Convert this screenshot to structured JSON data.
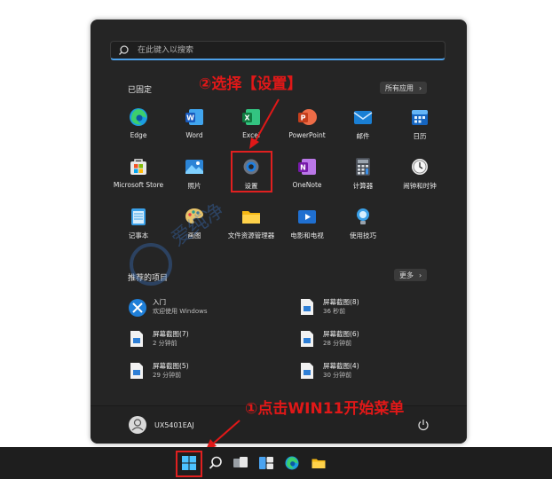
{
  "search": {
    "placeholder": "在此键入以搜索"
  },
  "pinned": {
    "title": "已固定",
    "all_apps": "所有应用",
    "apps": [
      {
        "label": "Edge"
      },
      {
        "label": "Word"
      },
      {
        "label": "Excel"
      },
      {
        "label": "PowerPoint"
      },
      {
        "label": "邮件"
      },
      {
        "label": "日历"
      },
      {
        "label": "Microsoft Store"
      },
      {
        "label": "照片"
      },
      {
        "label": "设置"
      },
      {
        "label": "OneNote"
      },
      {
        "label": "计算器"
      },
      {
        "label": "闹钟和时钟"
      },
      {
        "label": "记事本"
      },
      {
        "label": "画图"
      },
      {
        "label": "文件资源管理器"
      },
      {
        "label": "电影和电视"
      },
      {
        "label": "使用技巧"
      }
    ]
  },
  "recommended": {
    "title": "推荐的项目",
    "more": "更多",
    "items": [
      {
        "title": "入门",
        "subtitle": "欢迎使用 Windows"
      },
      {
        "title": "屏幕截图(8)",
        "subtitle": "36 秒前"
      },
      {
        "title": "屏幕截图(7)",
        "subtitle": "2 分钟前"
      },
      {
        "title": "屏幕截图(6)",
        "subtitle": "28 分钟前"
      },
      {
        "title": "屏幕截图(5)",
        "subtitle": "29 分钟前"
      },
      {
        "title": "屏幕截图(4)",
        "subtitle": "30 分钟前"
      }
    ]
  },
  "user": {
    "name": "UX5401EAJ"
  },
  "annotations": {
    "step1": "①点击WIN11开始菜单",
    "step2": "②选择【设置】"
  },
  "colors": {
    "accent": "#4ca0e8",
    "annotation": "#e01818",
    "menu_bg": "#252525",
    "taskbar_bg": "#1e1e1e"
  }
}
